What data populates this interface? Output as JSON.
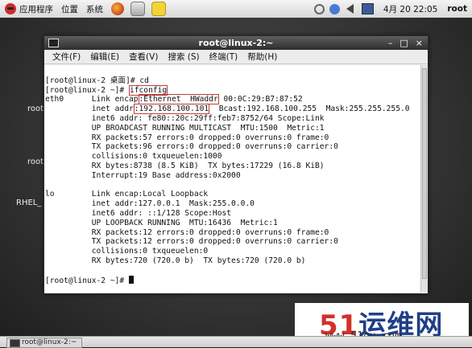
{
  "top_panel": {
    "apps_label": "应用程序",
    "places_label": "位置",
    "system_label": "系统",
    "clock": "4月 20 22:05",
    "user": "root",
    "icons": [
      "fedora-icon",
      "firefox-icon",
      "mail-icon",
      "notes-icon",
      "update-icon",
      "help-icon",
      "volume-icon",
      "network-icon"
    ]
  },
  "desktop": {
    "labels": [
      "root",
      "root",
      "RHEL_"
    ]
  },
  "window": {
    "title": "root@linux-2:~",
    "controls": [
      "–",
      "□",
      "×"
    ],
    "menus": [
      "文件(F)",
      "编辑(E)",
      "查看(V)",
      "搜索 (S)",
      "终端(T)",
      "帮助(H)"
    ]
  },
  "terminal": {
    "line1": "[root@linux-2 桌面]# cd",
    "prompt2": "[root@linux-2 ~]# ",
    "cmd2": "ifconfig",
    "eth0_link_pre": "eth0      Link encap",
    "eth0_link_hl": ":Ethernet  HWaddr",
    "eth0_link_post": " 00:0C:29:B7:87:52",
    "inet_pre": "          inet addr",
    "inet_hl": ":192.168.100.101",
    "inet_post": "  Bcast:192.168.100.255  Mask:255.255.255.0",
    "eth0_rest": [
      "          inet6 addr: fe80::20c:29ff:feb7:8752/64 Scope:Link",
      "          UP BROADCAST RUNNING MULTICAST  MTU:1500  Metric:1",
      "          RX packets:57 errors:0 dropped:0 overruns:0 frame:0",
      "          TX packets:96 errors:0 dropped:0 overruns:0 carrier:0",
      "          collisions:0 txqueuelen:1000",
      "          RX bytes:8738 (8.5 KiB)  TX bytes:17229 (16.8 KiB)",
      "          Interrupt:19 Base address:0x2000"
    ],
    "lo_lines": [
      "lo        Link encap:Local Loopback",
      "          inet addr:127.0.0.1  Mask:255.0.0.0",
      "          inet6 addr: ::1/128 Scope:Host",
      "          UP LOOPBACK RUNNING  MTU:16436  Metric:1",
      "          RX packets:12 errors:0 dropped:0 overruns:0 frame:0",
      "          TX packets:12 errors:0 dropped:0 overruns:0 carrier:0",
      "          collisions:0 txqueuelen:0",
      "          RX bytes:720 (720.0 b)  TX bytes:720 (720.0 b)"
    ],
    "final_prompt": "[root@linux-2 ~]# "
  },
  "taskbar": {
    "task_label": "root@linux-2:~"
  },
  "watermark": {
    "brand_num": "51",
    "brand_text": "运维网",
    "url": "www.51ou.com"
  }
}
